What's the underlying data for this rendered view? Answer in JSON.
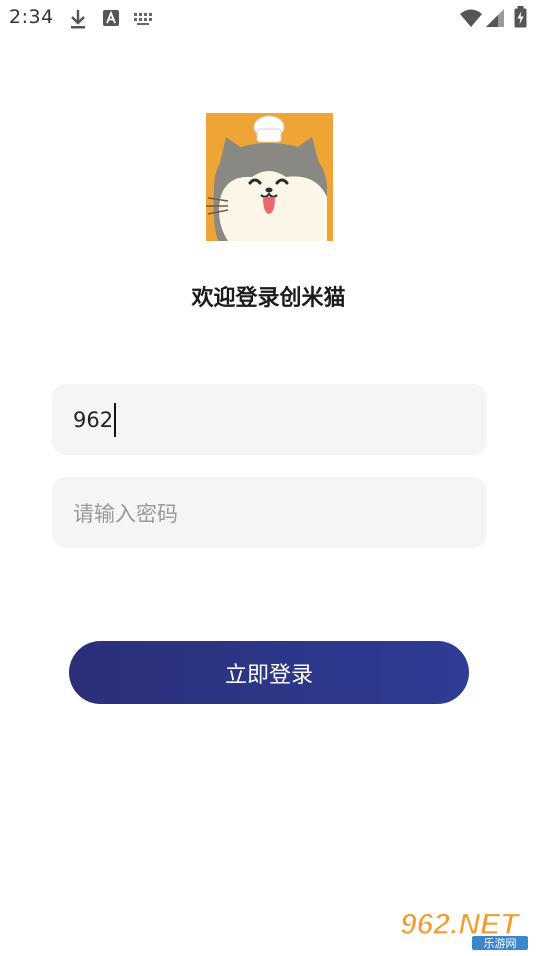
{
  "status_bar": {
    "time": "2:34"
  },
  "welcome_title": "欢迎登录创米猫",
  "username": {
    "value": "962"
  },
  "password": {
    "placeholder": "请输入密码"
  },
  "login_button": {
    "label": "立即登录"
  },
  "watermark": {
    "main": "962.NET",
    "sub": "乐游网"
  },
  "colors": {
    "button_start": "#2b2f78",
    "button_end": "#2f3c95",
    "field_bg": "#f5f5f5",
    "logo_bg": "#eea536"
  }
}
